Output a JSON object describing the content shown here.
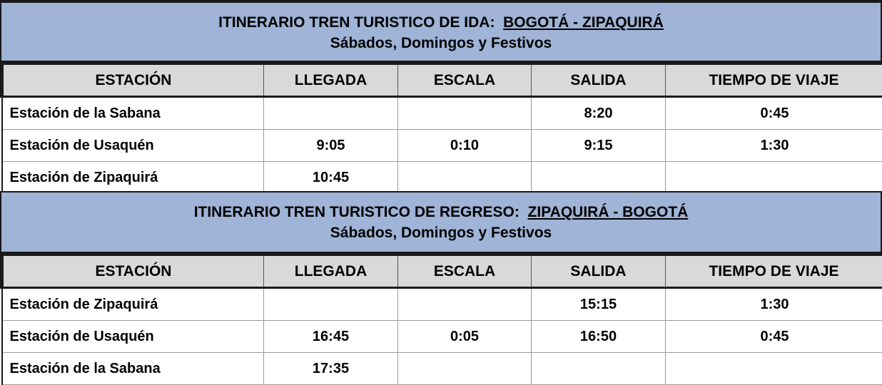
{
  "ida": {
    "title_prefix": "ITINERARIO TREN TURISTICO DE IDA:",
    "route": "BOGOTÁ - ZIPAQUIRÁ",
    "subtitle": "Sábados, Domingos y Festivos",
    "headers": [
      "ESTACIÓN",
      "LLEGADA",
      "ESCALA",
      "SALIDA",
      "TIEMPO DE VIAJE"
    ],
    "rows": [
      [
        "Estación de la Sabana",
        "",
        "",
        "8:20",
        "0:45"
      ],
      [
        "Estación de Usaquén",
        "9:05",
        "0:10",
        "9:15",
        "1:30"
      ],
      [
        "Estación de Zipaquirá",
        "10:45",
        "",
        "",
        ""
      ]
    ]
  },
  "regreso": {
    "title_prefix": "ITINERARIO TREN TURISTICO DE REGRESO:",
    "route": "ZIPAQUIRÁ - BOGOTÁ",
    "subtitle": "Sábados, Domingos y Festivos",
    "headers": [
      "ESTACIÓN",
      "LLEGADA",
      "ESCALA",
      "SALIDA",
      "TIEMPO DE VIAJE"
    ],
    "rows": [
      [
        "Estación de Zipaquirá",
        "",
        "",
        "15:15",
        "1:30"
      ],
      [
        "Estación de Usaquén",
        "16:45",
        "0:05",
        "16:50",
        "0:45"
      ],
      [
        "Estación de la Sabana",
        "17:35",
        "",
        "",
        ""
      ]
    ]
  },
  "colors": {
    "title_band": "#9fb4d6",
    "header_band": "#d9d9d9"
  }
}
